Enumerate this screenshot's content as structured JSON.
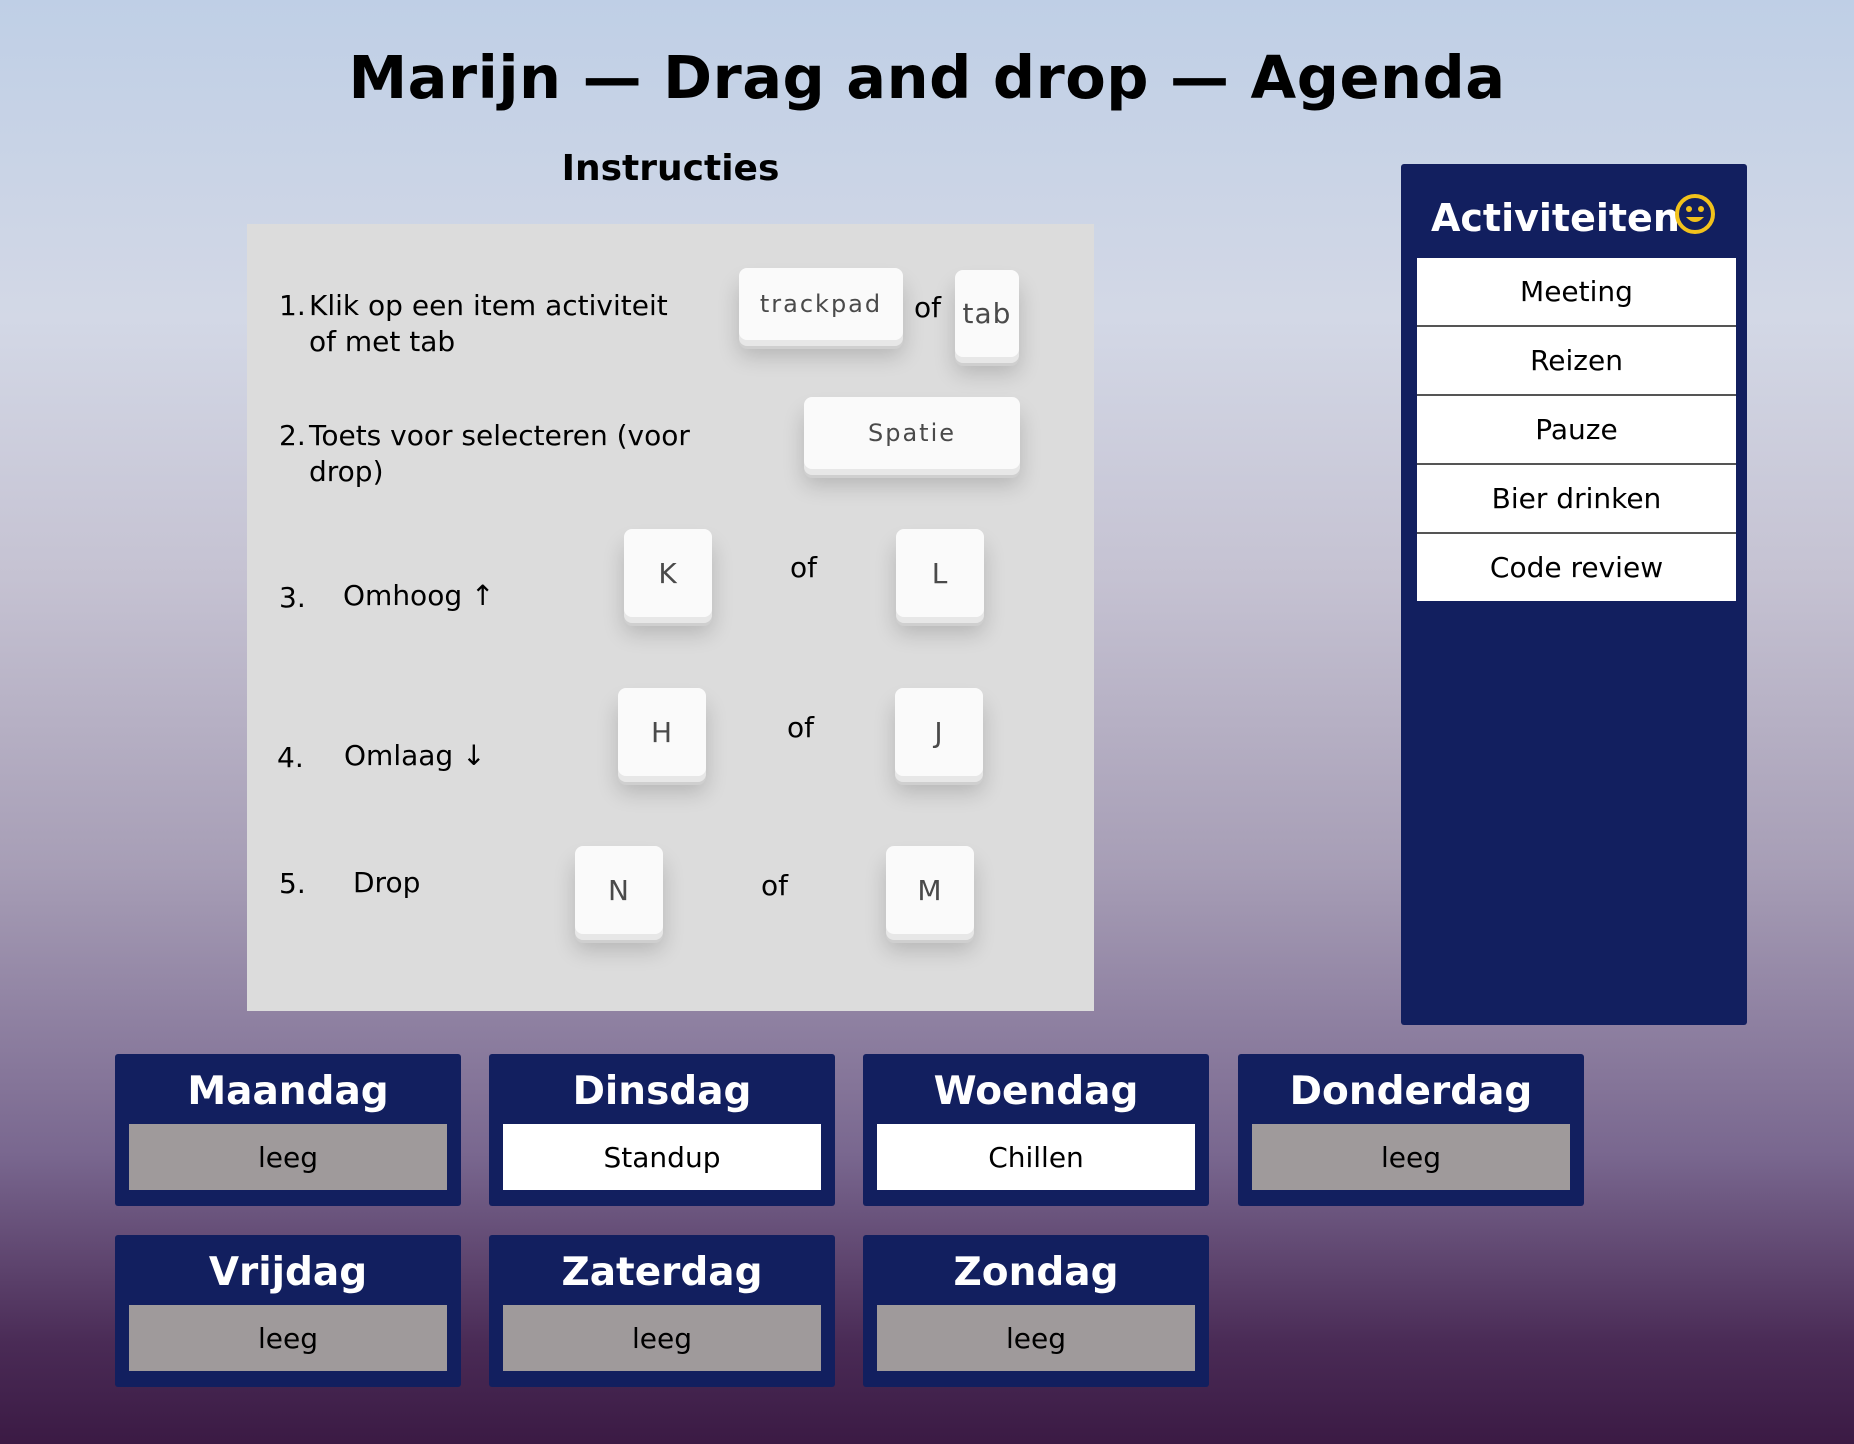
{
  "page": {
    "title": "Marijn — Drag and drop — Agenda"
  },
  "instructions": {
    "heading": "Instructies",
    "steps": [
      {
        "num": "1.",
        "text": "Klik op een item activiteit of met tab",
        "keys": [
          "trackpad",
          "tab"
        ],
        "or": "of"
      },
      {
        "num": "2.",
        "text": "Toets voor selecteren (voor drop)",
        "keys": [
          "Spatie"
        ]
      },
      {
        "num": "3.",
        "text": "Omhoog ↑",
        "keys": [
          "K",
          "L"
        ],
        "or": "of"
      },
      {
        "num": "4.",
        "text": "Omlaag ↓",
        "keys": [
          "H",
          "J"
        ],
        "or": "of"
      },
      {
        "num": "5.",
        "text": "Drop",
        "keys": [
          "N",
          "M"
        ],
        "or": "of"
      }
    ]
  },
  "activities": {
    "title": "Activiteiten",
    "icon": "smiley-icon",
    "items": [
      "Meeting",
      "Reizen",
      "Pauze",
      "Bier drinken",
      "Code review"
    ]
  },
  "days": [
    {
      "name": "Maandag",
      "value": "leeg",
      "filled": false
    },
    {
      "name": "Dinsdag",
      "value": "Standup",
      "filled": true
    },
    {
      "name": "Woendag",
      "value": "Chillen",
      "filled": true
    },
    {
      "name": "Donderdag",
      "value": "leeg",
      "filled": false
    },
    {
      "name": "Vrijdag",
      "value": "leeg",
      "filled": false
    },
    {
      "name": "Zaterdag",
      "value": "leeg",
      "filled": false
    },
    {
      "name": "Zondag",
      "value": "leeg",
      "filled": false
    }
  ],
  "colors": {
    "panel": "#121f5f",
    "empty_slot": "#9f9a9b",
    "filled_slot": "#ffffff",
    "smiley": "#f2c21b"
  }
}
